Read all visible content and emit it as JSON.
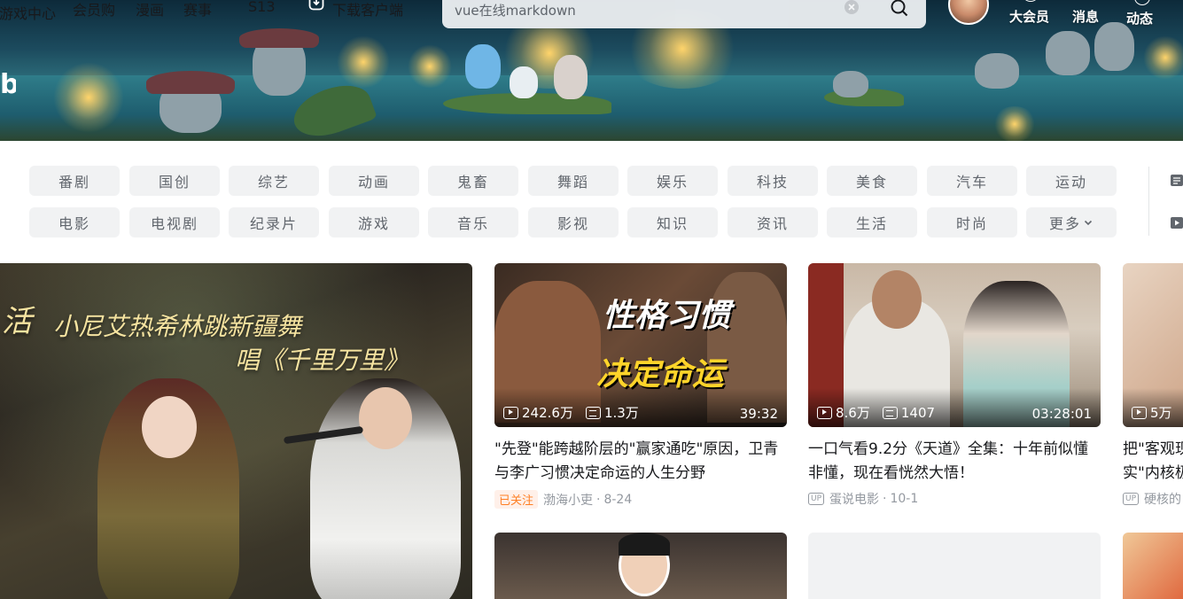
{
  "top_nav_left": [
    "游戏中心",
    "会员购",
    "漫画",
    "赛事",
    "S13"
  ],
  "download_label": "下载客户端",
  "search": {
    "value": "vue在线markdown"
  },
  "top_nav_right": [
    "大会员",
    "消息",
    "动态"
  ],
  "banner_logo_text": "bili",
  "chips_row1": [
    "番剧",
    "国创",
    "综艺",
    "动画",
    "鬼畜",
    "舞蹈",
    "娱乐",
    "科技",
    "美食",
    "汽车",
    "运动"
  ],
  "chips_row2": [
    "电影",
    "电视剧",
    "纪录片",
    "游戏",
    "音乐",
    "影视",
    "知识",
    "资讯",
    "生活",
    "时尚",
    "更多"
  ],
  "hero": {
    "corner_text": "活",
    "line1": "小尼艾热希林跳新疆舞",
    "line2": "唱《千里万里》"
  },
  "cards": [
    {
      "thumb_text1": "性格习惯",
      "thumb_text2": "决定命运",
      "views": "242.6万",
      "danmaku": "1.3万",
      "duration": "39:32",
      "title": "\"先登\"能跨越阶层的\"赢家通吃\"原因，卫青与李广习惯决定命运的人生分野",
      "tag": "已关注",
      "author": "渤海小吏",
      "date": "8-24"
    },
    {
      "views": "8.6万",
      "danmaku": "1407",
      "duration": "03:28:01",
      "title": "一口气看9.2分《天道》全集：十年前似懂非懂，现在看恍然大悟！",
      "up_badge": "UP",
      "author": "蛋说电影",
      "date": "10-1"
    },
    {
      "views": "5万",
      "title": "把\"客观现实\"内核极稳",
      "up_badge": "UP",
      "author": "硬核的"
    }
  ],
  "colors": {
    "accent": "#fb7299",
    "followed_tag": "#ff7f24",
    "chip_bg": "#f1f2f3"
  }
}
